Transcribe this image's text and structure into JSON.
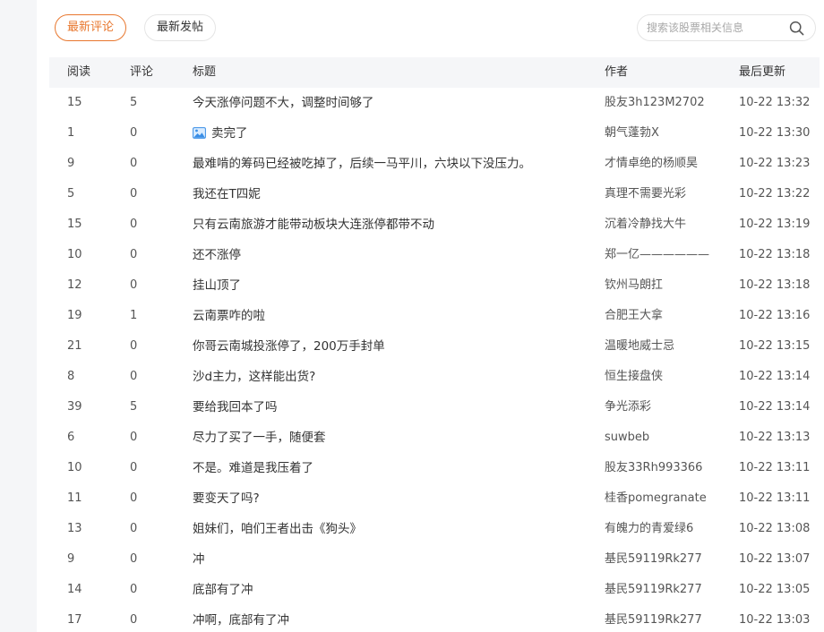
{
  "tabs": {
    "latest_comments": "最新评论",
    "latest_posts": "最新发帖"
  },
  "search": {
    "placeholder": "搜索该股票相关信息",
    "value": ""
  },
  "table": {
    "headers": {
      "read": "阅读",
      "comment": "评论",
      "title": "标题",
      "author": "作者",
      "updated": "最后更新"
    },
    "rows": [
      {
        "read": "15",
        "comment": "5",
        "title": "今天涨停问题不大，调整时间够了",
        "author": "股友3h123M2702",
        "time": "10-22 13:32",
        "image_icon": false
      },
      {
        "read": "1",
        "comment": "0",
        "title": "卖完了",
        "author": "朝气蓬勃X",
        "time": "10-22 13:30",
        "image_icon": true
      },
      {
        "read": "9",
        "comment": "0",
        "title": "最难啃的筹码已经被吃掉了，后续一马平川，六块以下没压力。",
        "author": "才情卓绝的杨顺昊",
        "time": "10-22 13:23",
        "image_icon": false
      },
      {
        "read": "5",
        "comment": "0",
        "title": "我还在T四妮",
        "author": "真理不需要光彩",
        "time": "10-22 13:22",
        "image_icon": false
      },
      {
        "read": "15",
        "comment": "0",
        "title": "只有云南旅游才能带动板块大连涨停都带不动",
        "author": "沉着冷静找大牛",
        "time": "10-22 13:19",
        "image_icon": false
      },
      {
        "read": "10",
        "comment": "0",
        "title": "还不涨停",
        "author": "郑一亿——————",
        "time": "10-22 13:18",
        "image_icon": false
      },
      {
        "read": "12",
        "comment": "0",
        "title": "挂山顶了",
        "author": "钦州马朗扛",
        "time": "10-22 13:18",
        "image_icon": false
      },
      {
        "read": "19",
        "comment": "1",
        "title": "云南票咋的啦",
        "author": "合肥王大拿",
        "time": "10-22 13:16",
        "image_icon": false
      },
      {
        "read": "21",
        "comment": "0",
        "title": "你哥云南城投涨停了，200万手封单",
        "author": "温暖地威士忌",
        "time": "10-22 13:15",
        "image_icon": false
      },
      {
        "read": "8",
        "comment": "0",
        "title": "沙d主力，这样能出货?",
        "author": "恒生接盘侠",
        "time": "10-22 13:14",
        "image_icon": false
      },
      {
        "read": "39",
        "comment": "5",
        "title": "要给我回本了吗",
        "author": "争光添彩",
        "time": "10-22 13:14",
        "image_icon": false
      },
      {
        "read": "6",
        "comment": "0",
        "title": "尽力了买了一手，随便套",
        "author": "suwbeb",
        "time": "10-22 13:13",
        "image_icon": false
      },
      {
        "read": "10",
        "comment": "0",
        "title": "不是。难道是我压着了",
        "author": "股友33Rh993366",
        "time": "10-22 13:11",
        "image_icon": false
      },
      {
        "read": "11",
        "comment": "0",
        "title": "要变天了吗?",
        "author": "桂香pomegranate",
        "time": "10-22 13:11",
        "image_icon": false
      },
      {
        "read": "13",
        "comment": "0",
        "title": "姐妹们，咱们王者出击《狗头》",
        "author": "有魄力的青爱绿6",
        "time": "10-22 13:08",
        "image_icon": false
      },
      {
        "read": "9",
        "comment": "0",
        "title": "冲",
        "author": "基民59119Rk277",
        "time": "10-22 13:07",
        "image_icon": false
      },
      {
        "read": "14",
        "comment": "0",
        "title": "底部有了冲",
        "author": "基民59119Rk277",
        "time": "10-22 13:05",
        "image_icon": false
      },
      {
        "read": "17",
        "comment": "0",
        "title": "冲啊，底部有了冲",
        "author": "基民59119Rk277",
        "time": "10-22 13:03",
        "image_icon": false
      }
    ]
  },
  "colors": {
    "accent": "#e8772e",
    "header_bg": "#f5f6f8",
    "image_icon": "#3a8ee6"
  },
  "icons": {
    "search": "search-icon",
    "image": "image-icon"
  }
}
